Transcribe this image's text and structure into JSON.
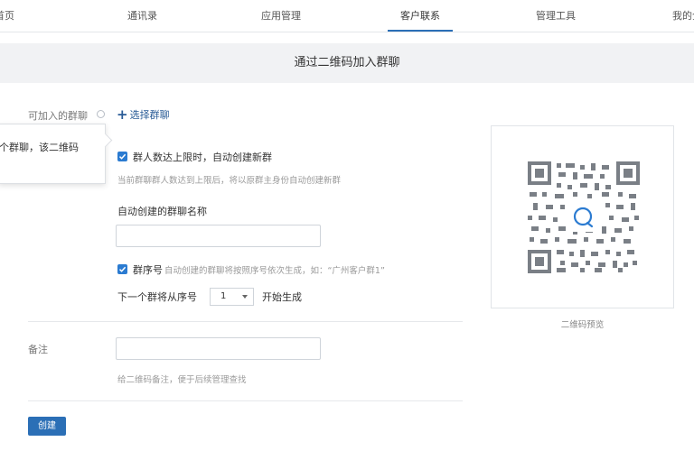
{
  "nav": {
    "tabs": [
      {
        "label": "首页",
        "active": false
      },
      {
        "label": "通讯录",
        "active": false
      },
      {
        "label": "应用管理",
        "active": false
      },
      {
        "label": "客户联系",
        "active": true
      },
      {
        "label": "管理工具",
        "active": false
      },
      {
        "label": "我的企业",
        "active": false
      }
    ]
  },
  "page": {
    "title": "通过二维码加入群聊"
  },
  "form": {
    "groups_label": "可加入的群聊",
    "select_groups_link": "选择群聊",
    "tooltip_text": "个群聊，该二维码",
    "auto_create": {
      "checked": true,
      "label": "群人数达上限时，自动创建新群",
      "hint": "当前群聊群人数达到上限后，将以原群主身份自动创建新群"
    },
    "auto_name": {
      "label": "自动创建的群聊名称",
      "value": "",
      "placeholder": ""
    },
    "group_number": {
      "checked": true,
      "label": "群序号",
      "hint": "自动创建的群聊将按照序号依次生成，如：“广州客户群1”",
      "next_label": "下一个群将从序号",
      "next_value": "1",
      "next_suffix": "开始生成"
    },
    "remark": {
      "label": "备注",
      "value": "",
      "placeholder": "",
      "hint": "给二维码备注，便于后续管理查找"
    },
    "create_button": "创建"
  },
  "qr": {
    "caption": "二维码预览",
    "icon": "qr-code-icon",
    "accent_color": "#2b7bd1"
  },
  "colors": {
    "primary": "#2b6fb6",
    "checkbox": "#2b7bd1",
    "link": "#2a5c97"
  }
}
